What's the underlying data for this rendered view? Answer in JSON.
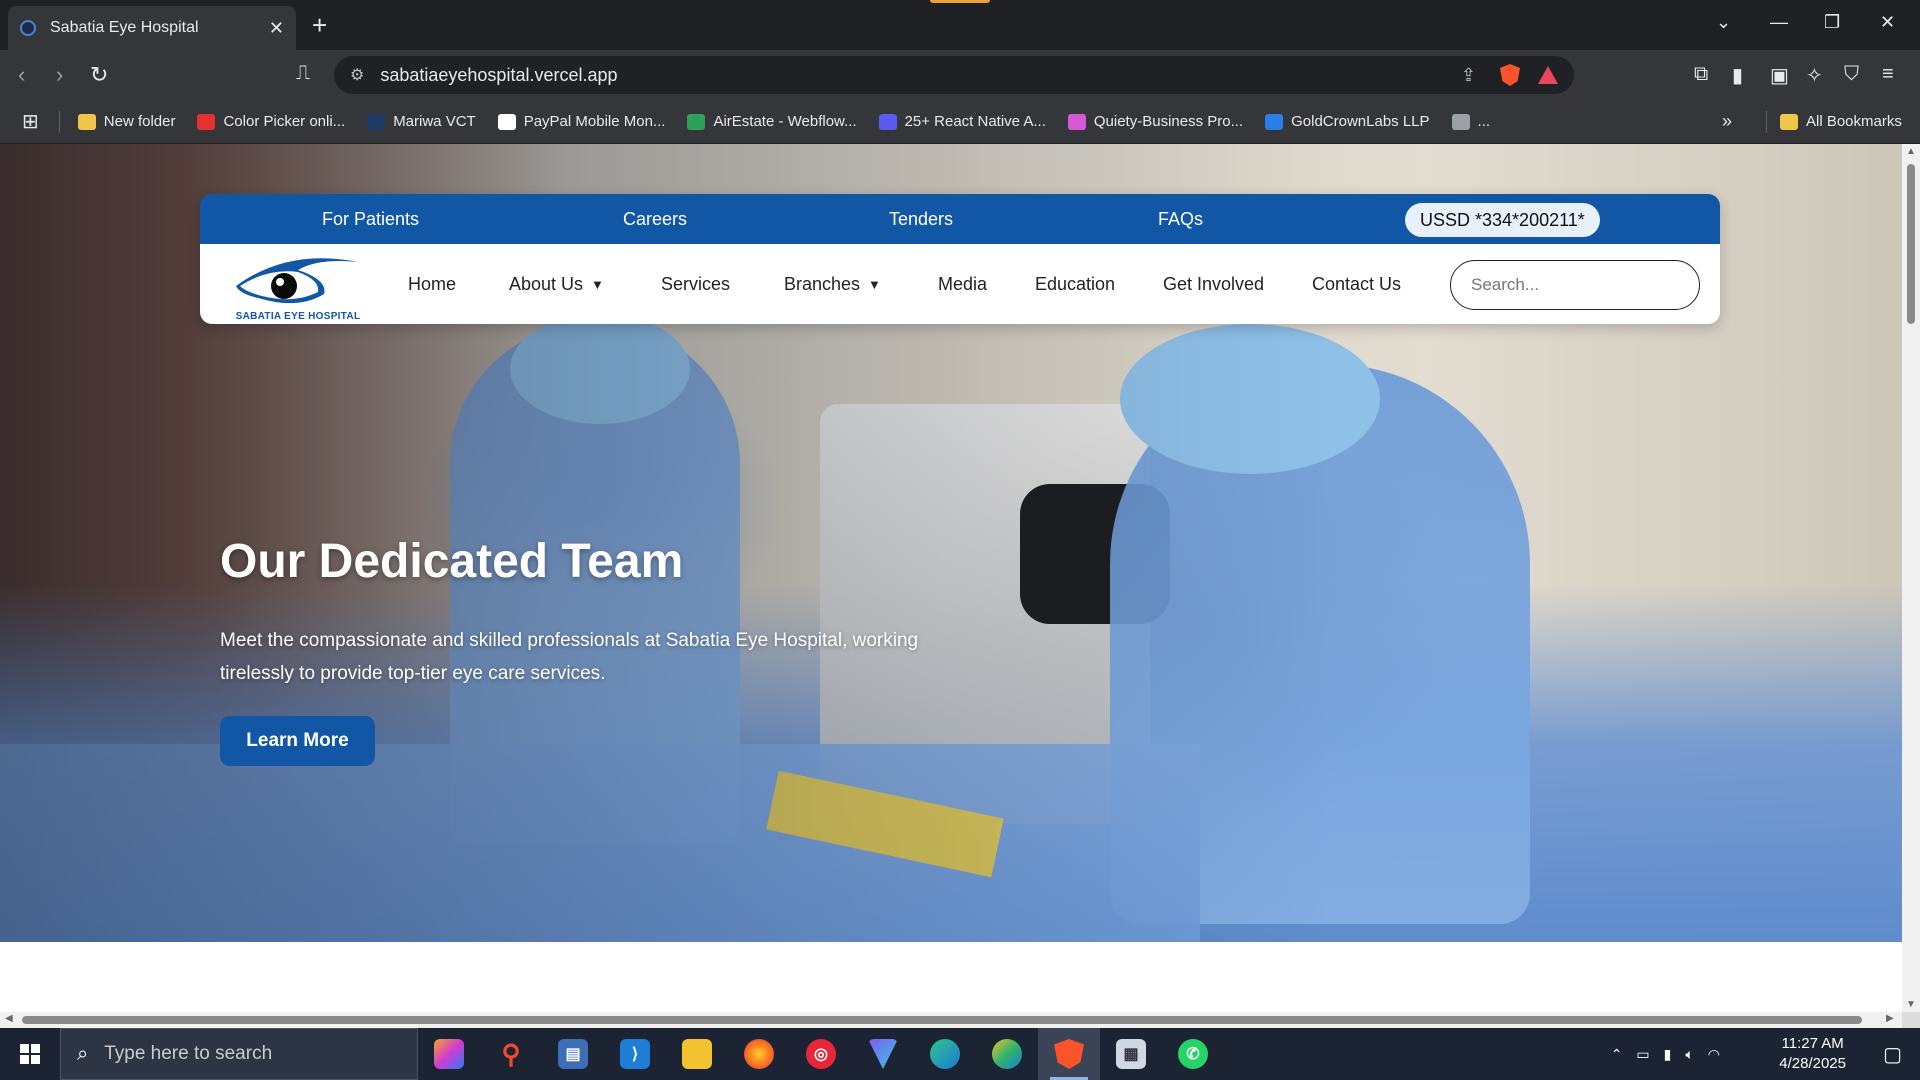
{
  "browser": {
    "tab_title": "Sabatia Eye Hospital",
    "tab_close": "✕",
    "new_tab": "+",
    "url": "sabatiaeyehospital.vercel.app",
    "bookmarks": [
      {
        "label": "New folder",
        "color": "#f0c54a"
      },
      {
        "label": "Color Picker onli...",
        "color": "#e5322d"
      },
      {
        "label": "Mariwa VCT",
        "color": "#1f3a66"
      },
      {
        "label": "PayPal Mobile Mon...",
        "color": "#ffffff"
      },
      {
        "label": "AirEstate - Webflow...",
        "color": "#2e9e5b"
      },
      {
        "label": "25+ React Native A...",
        "color": "#5b5bf0"
      },
      {
        "label": "Quiety-Business Pro...",
        "color": "#d65ad8"
      },
      {
        "label": "GoldCrownLabs LLP",
        "color": "#2b7de9"
      },
      {
        "label": "...",
        "color": "#9aa0a6"
      }
    ],
    "all_bookmarks": "All Bookmarks",
    "overflow": "»"
  },
  "site": {
    "top_links": [
      "For Patients",
      "Careers",
      "Tenders",
      "FAQs"
    ],
    "ussd": "USSD *334*200211*",
    "logo_text": "SABATIA EYE HOSPITAL",
    "nav": [
      "Home",
      "About Us",
      "Services",
      "Branches",
      "Media",
      "Education",
      "Get Involved",
      "Contact Us"
    ],
    "search_placeholder": "Search...",
    "hero_title": "Our Dedicated Team",
    "hero_desc": "Meet the compassionate and skilled professionals at Sabatia Eye Hospital, working tirelessly to provide top-tier eye care services.",
    "cta": "Learn More",
    "brand_color": "#1157a6"
  },
  "taskbar": {
    "search_placeholder": "Type here to search",
    "time": "11:27 AM",
    "date": "4/28/2025"
  }
}
